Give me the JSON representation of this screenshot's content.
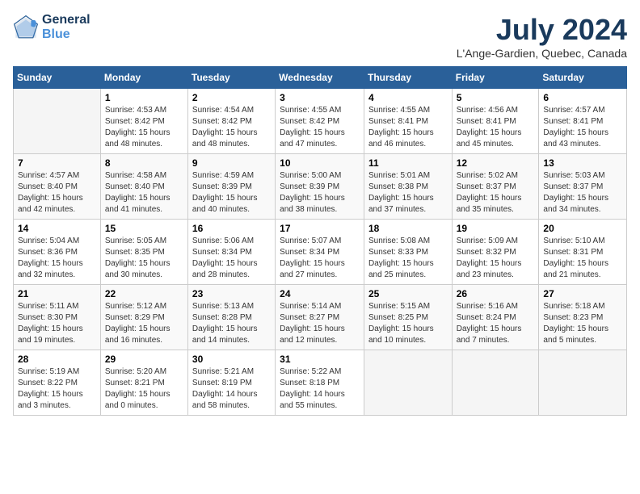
{
  "logo": {
    "line1": "General",
    "line2": "Blue"
  },
  "title": "July 2024",
  "location": "L'Ange-Gardien, Quebec, Canada",
  "days_of_week": [
    "Sunday",
    "Monday",
    "Tuesday",
    "Wednesday",
    "Thursday",
    "Friday",
    "Saturday"
  ],
  "weeks": [
    [
      {
        "day": "",
        "info": ""
      },
      {
        "day": "1",
        "info": "Sunrise: 4:53 AM\nSunset: 8:42 PM\nDaylight: 15 hours\nand 48 minutes."
      },
      {
        "day": "2",
        "info": "Sunrise: 4:54 AM\nSunset: 8:42 PM\nDaylight: 15 hours\nand 48 minutes."
      },
      {
        "day": "3",
        "info": "Sunrise: 4:55 AM\nSunset: 8:42 PM\nDaylight: 15 hours\nand 47 minutes."
      },
      {
        "day": "4",
        "info": "Sunrise: 4:55 AM\nSunset: 8:41 PM\nDaylight: 15 hours\nand 46 minutes."
      },
      {
        "day": "5",
        "info": "Sunrise: 4:56 AM\nSunset: 8:41 PM\nDaylight: 15 hours\nand 45 minutes."
      },
      {
        "day": "6",
        "info": "Sunrise: 4:57 AM\nSunset: 8:41 PM\nDaylight: 15 hours\nand 43 minutes."
      }
    ],
    [
      {
        "day": "7",
        "info": "Sunrise: 4:57 AM\nSunset: 8:40 PM\nDaylight: 15 hours\nand 42 minutes."
      },
      {
        "day": "8",
        "info": "Sunrise: 4:58 AM\nSunset: 8:40 PM\nDaylight: 15 hours\nand 41 minutes."
      },
      {
        "day": "9",
        "info": "Sunrise: 4:59 AM\nSunset: 8:39 PM\nDaylight: 15 hours\nand 40 minutes."
      },
      {
        "day": "10",
        "info": "Sunrise: 5:00 AM\nSunset: 8:39 PM\nDaylight: 15 hours\nand 38 minutes."
      },
      {
        "day": "11",
        "info": "Sunrise: 5:01 AM\nSunset: 8:38 PM\nDaylight: 15 hours\nand 37 minutes."
      },
      {
        "day": "12",
        "info": "Sunrise: 5:02 AM\nSunset: 8:37 PM\nDaylight: 15 hours\nand 35 minutes."
      },
      {
        "day": "13",
        "info": "Sunrise: 5:03 AM\nSunset: 8:37 PM\nDaylight: 15 hours\nand 34 minutes."
      }
    ],
    [
      {
        "day": "14",
        "info": "Sunrise: 5:04 AM\nSunset: 8:36 PM\nDaylight: 15 hours\nand 32 minutes."
      },
      {
        "day": "15",
        "info": "Sunrise: 5:05 AM\nSunset: 8:35 PM\nDaylight: 15 hours\nand 30 minutes."
      },
      {
        "day": "16",
        "info": "Sunrise: 5:06 AM\nSunset: 8:34 PM\nDaylight: 15 hours\nand 28 minutes."
      },
      {
        "day": "17",
        "info": "Sunrise: 5:07 AM\nSunset: 8:34 PM\nDaylight: 15 hours\nand 27 minutes."
      },
      {
        "day": "18",
        "info": "Sunrise: 5:08 AM\nSunset: 8:33 PM\nDaylight: 15 hours\nand 25 minutes."
      },
      {
        "day": "19",
        "info": "Sunrise: 5:09 AM\nSunset: 8:32 PM\nDaylight: 15 hours\nand 23 minutes."
      },
      {
        "day": "20",
        "info": "Sunrise: 5:10 AM\nSunset: 8:31 PM\nDaylight: 15 hours\nand 21 minutes."
      }
    ],
    [
      {
        "day": "21",
        "info": "Sunrise: 5:11 AM\nSunset: 8:30 PM\nDaylight: 15 hours\nand 19 minutes."
      },
      {
        "day": "22",
        "info": "Sunrise: 5:12 AM\nSunset: 8:29 PM\nDaylight: 15 hours\nand 16 minutes."
      },
      {
        "day": "23",
        "info": "Sunrise: 5:13 AM\nSunset: 8:28 PM\nDaylight: 15 hours\nand 14 minutes."
      },
      {
        "day": "24",
        "info": "Sunrise: 5:14 AM\nSunset: 8:27 PM\nDaylight: 15 hours\nand 12 minutes."
      },
      {
        "day": "25",
        "info": "Sunrise: 5:15 AM\nSunset: 8:25 PM\nDaylight: 15 hours\nand 10 minutes."
      },
      {
        "day": "26",
        "info": "Sunrise: 5:16 AM\nSunset: 8:24 PM\nDaylight: 15 hours\nand 7 minutes."
      },
      {
        "day": "27",
        "info": "Sunrise: 5:18 AM\nSunset: 8:23 PM\nDaylight: 15 hours\nand 5 minutes."
      }
    ],
    [
      {
        "day": "28",
        "info": "Sunrise: 5:19 AM\nSunset: 8:22 PM\nDaylight: 15 hours\nand 3 minutes."
      },
      {
        "day": "29",
        "info": "Sunrise: 5:20 AM\nSunset: 8:21 PM\nDaylight: 15 hours\nand 0 minutes."
      },
      {
        "day": "30",
        "info": "Sunrise: 5:21 AM\nSunset: 8:19 PM\nDaylight: 14 hours\nand 58 minutes."
      },
      {
        "day": "31",
        "info": "Sunrise: 5:22 AM\nSunset: 8:18 PM\nDaylight: 14 hours\nand 55 minutes."
      },
      {
        "day": "",
        "info": ""
      },
      {
        "day": "",
        "info": ""
      },
      {
        "day": "",
        "info": ""
      }
    ]
  ]
}
